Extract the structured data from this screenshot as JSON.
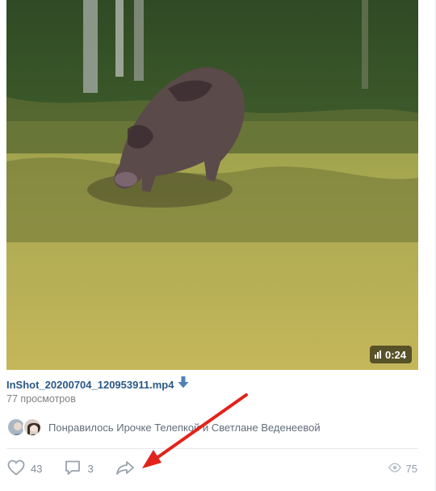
{
  "video": {
    "duration": "0:24"
  },
  "file": {
    "name": "InShot_20200704_120953911.mp4",
    "views": "77 просмотров"
  },
  "likes_line": "Понравилось Ирочке Телепкой и Светлане Веденеевой",
  "actions": {
    "likes": "43",
    "comments": "3",
    "views": "75"
  },
  "icons": {
    "download": "download-arrow-icon",
    "like": "heart-icon",
    "comment": "comment-bubble-icon",
    "share": "share-arrow-icon",
    "views": "eye-icon"
  },
  "colors": {
    "link": "#2a5885",
    "muted": "#828282",
    "icon": "#828a99",
    "annotation": "#e2231a"
  }
}
